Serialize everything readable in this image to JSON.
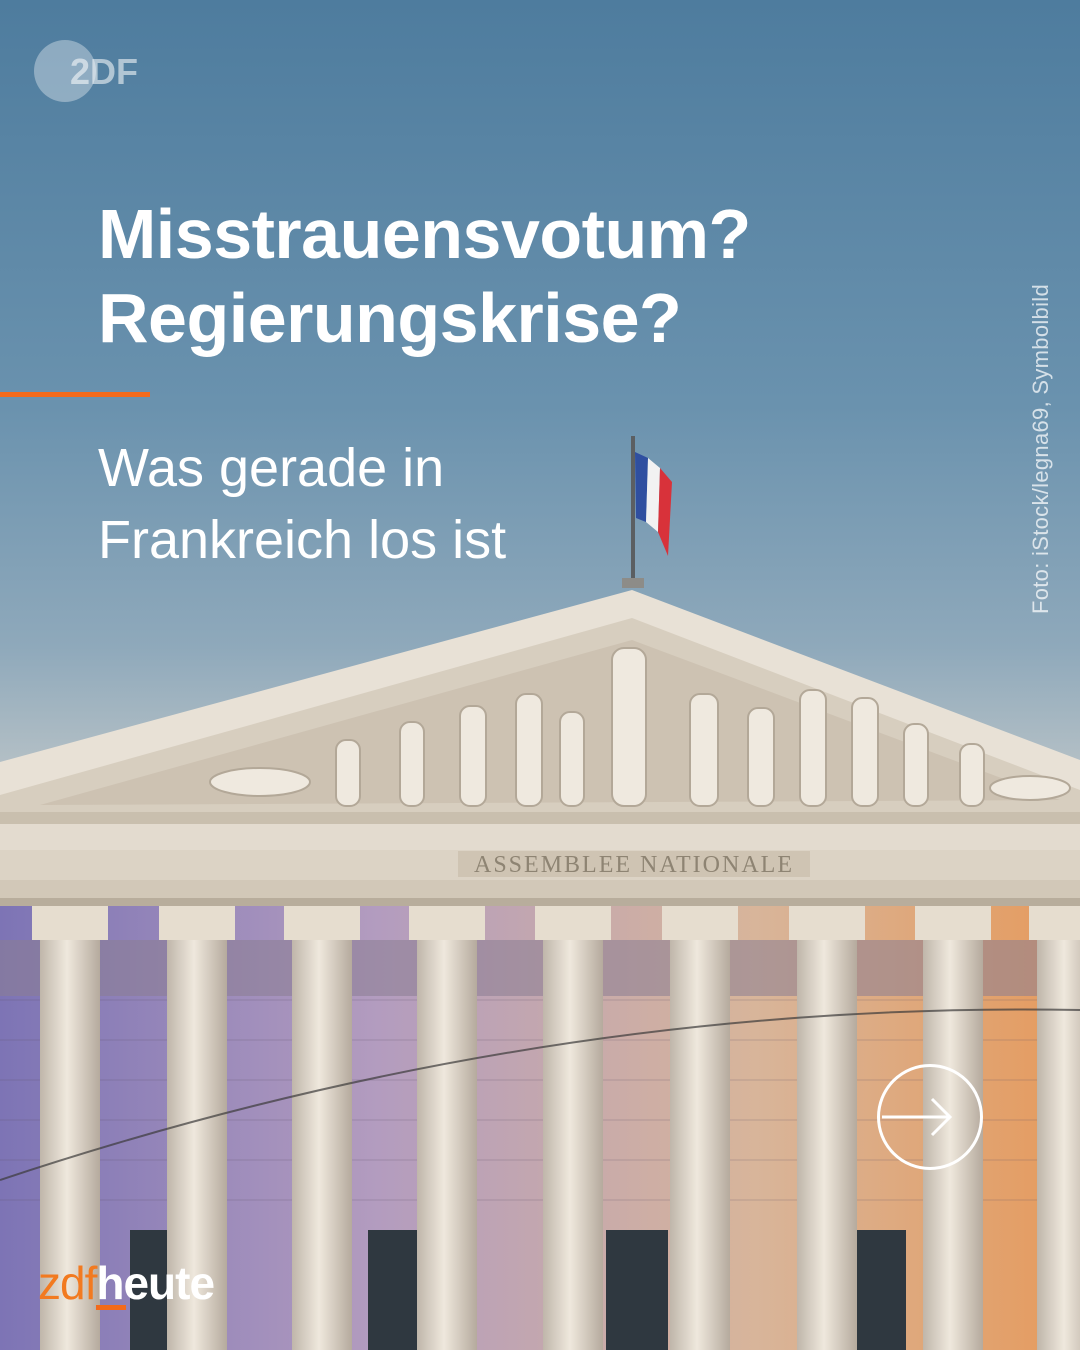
{
  "post": {
    "headline_lines": [
      "Misstrauensvotum?",
      "Regierungskrise?"
    ],
    "subline_lines": [
      "Was gerade in",
      "Frankreich los ist"
    ],
    "photo_credit": "Foto: iStock/legna69, Symbolbild",
    "building_inscription": "ASSEMBLEE NATIONALE"
  },
  "branding": {
    "top_logo": "2DF",
    "bottom_logo_left": "zdf",
    "bottom_logo_right": "heute"
  },
  "icons": {
    "next": "arrow-right-circle-icon",
    "flag": "french-flag-icon"
  },
  "colors": {
    "accent": "#f26a1b",
    "sky_top": "#4e7c9e",
    "stone": "#d9cfc0",
    "text": "#ffffff"
  }
}
